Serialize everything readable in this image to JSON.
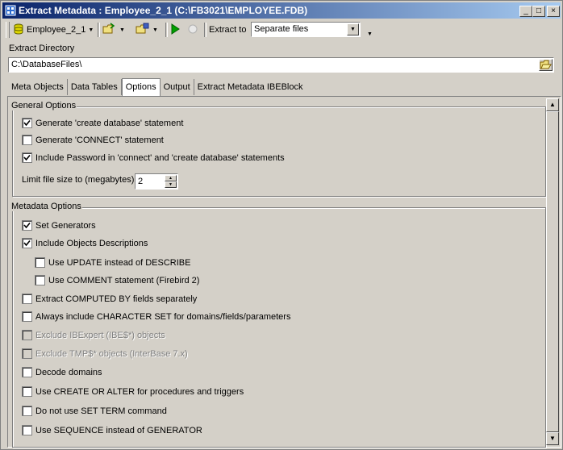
{
  "window": {
    "title": "Extract Metadata : Employee_2_1 (C:\\FB3021\\EMPLOYEE.FDB)",
    "min_btn": "_",
    "max_btn": "□",
    "close_btn": "×"
  },
  "toolbar": {
    "database_label": "Employee_2_1",
    "extract_to_label": "Extract to",
    "extract_to_value": "Separate files"
  },
  "directory": {
    "label": "Extract Directory",
    "value": "C:\\DatabaseFiles\\"
  },
  "tabs": [
    {
      "label": "Meta Objects"
    },
    {
      "label": "Data Tables"
    },
    {
      "label": "Options"
    },
    {
      "label": "Output"
    },
    {
      "label": "Extract Metadata IBEBlock"
    }
  ],
  "active_tab": "Options",
  "general": {
    "title": "General Options",
    "items": [
      {
        "label": "Generate 'create database' statement",
        "checked": true
      },
      {
        "label": "Generate 'CONNECT' statement",
        "checked": false
      },
      {
        "label": "Include Password in 'connect' and 'create database' statements",
        "checked": true
      }
    ],
    "limit_label": "Limit file size to (megabytes)",
    "limit_value": "2"
  },
  "metadata": {
    "title": "Metadata Options",
    "items": [
      {
        "label": "Set Generators",
        "checked": true,
        "disabled": false
      },
      {
        "label": "Include Objects Descriptions",
        "checked": true,
        "disabled": false
      },
      {
        "label": "Use UPDATE instead of DESCRIBE",
        "checked": false,
        "disabled": false
      },
      {
        "label": "Use COMMENT statement (Firebird 2)",
        "checked": false,
        "disabled": false
      },
      {
        "label": "Extract COMPUTED BY fields separately",
        "checked": false,
        "disabled": false
      },
      {
        "label": "Always include CHARACTER SET for domains/fields/parameters",
        "checked": false,
        "disabled": false
      },
      {
        "label": "Exclude IBExpert (IBE$*) objects",
        "checked": false,
        "disabled": true
      },
      {
        "label": "Exclude TMP$* objects (InterBase 7.x)",
        "checked": false,
        "disabled": true
      },
      {
        "label": "Decode domains",
        "checked": false,
        "disabled": false
      },
      {
        "label": "Use CREATE OR ALTER for procedures and triggers",
        "checked": false,
        "disabled": false
      },
      {
        "label": "Do not use SET TERM command",
        "checked": false,
        "disabled": false
      },
      {
        "label": "Use SEQUENCE instead of GENERATOR",
        "checked": false,
        "disabled": false
      }
    ]
  },
  "colors": {
    "titlebar_start": "#0a246a",
    "titlebar_end": "#a6caf0",
    "face": "#d4d0c8",
    "run_green": "#00a000"
  }
}
